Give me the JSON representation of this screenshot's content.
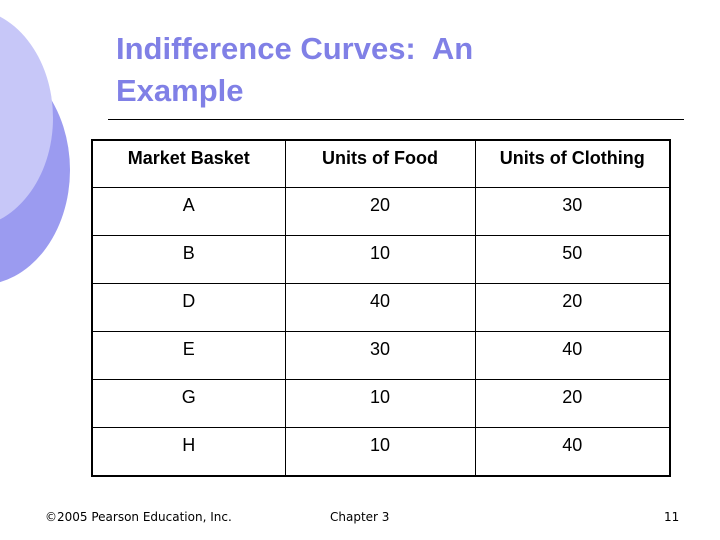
{
  "slide": {
    "title": "Indifference Curves:  An\nExample",
    "accent_color": "#8080e6"
  },
  "table": {
    "headers": [
      "Market Basket",
      "Units of Food",
      "Units of Clothing"
    ],
    "rows": [
      [
        "A",
        "20",
        "30"
      ],
      [
        "B",
        "10",
        "50"
      ],
      [
        "D",
        "40",
        "20"
      ],
      [
        "E",
        "30",
        "40"
      ],
      [
        "G",
        "10",
        "20"
      ],
      [
        "H",
        "10",
        "40"
      ]
    ]
  },
  "footer": {
    "copyright": "©2005 Pearson Education, Inc.",
    "chapter": "Chapter 3",
    "page_number": "11"
  }
}
